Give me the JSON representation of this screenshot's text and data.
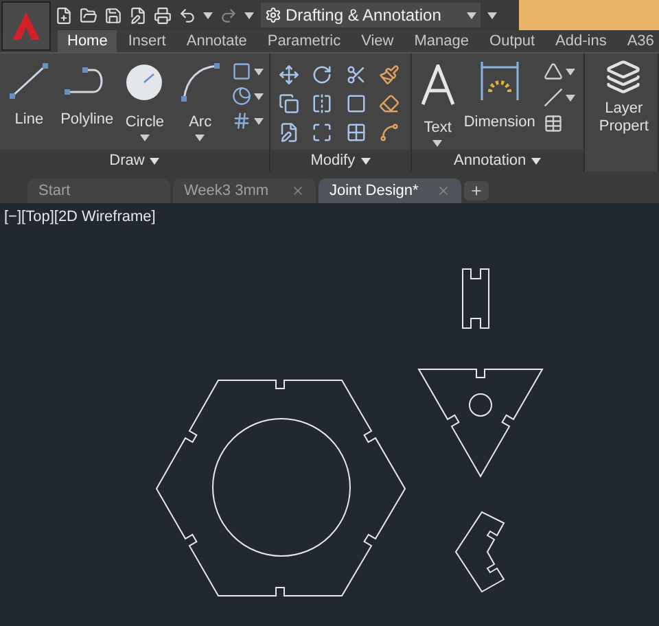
{
  "title_bar": {
    "workspace": "Drafting & Annotation"
  },
  "ribbon_tabs": [
    {
      "label": "Home",
      "selected": true
    },
    {
      "label": "Insert",
      "selected": false
    },
    {
      "label": "Annotate",
      "selected": false
    },
    {
      "label": "Parametric",
      "selected": false
    },
    {
      "label": "View",
      "selected": false
    },
    {
      "label": "Manage",
      "selected": false
    },
    {
      "label": "Output",
      "selected": false
    },
    {
      "label": "Add-ins",
      "selected": false
    },
    {
      "label": "A36",
      "selected": false
    }
  ],
  "panels": [
    {
      "kind": "draw",
      "title": "Draw",
      "tools": [
        "Line",
        "Polyline",
        "Circle",
        "Arc"
      ]
    },
    {
      "kind": "modify",
      "title": "Modify"
    },
    {
      "kind": "annotation",
      "title": "Annotation",
      "tools": [
        "Text",
        "Dimension"
      ]
    },
    {
      "kind": "layers",
      "tools": [
        "Layer",
        "Propert"
      ]
    }
  ],
  "doc_tabs": [
    {
      "label": "Start",
      "selected": false,
      "closable": false
    },
    {
      "label": "Week3 3mm",
      "selected": false,
      "closable": true
    },
    {
      "label": "Joint Design*",
      "selected": true,
      "closable": true
    }
  ],
  "viewport": {
    "label": "[−][Top][2D Wireframe]"
  }
}
